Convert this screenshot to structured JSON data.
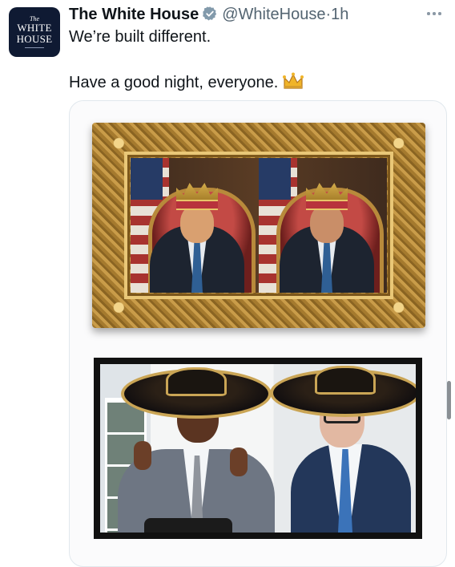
{
  "account": {
    "name": "The White House",
    "handle": "@WhiteHouse",
    "separator": "·",
    "time": "1h",
    "verified_color": "#829aab",
    "avatar": {
      "line1": "The",
      "line2": "WHITE",
      "line3": "HOUSE",
      "background": "#0f1a33"
    }
  },
  "tweet": {
    "line1": "We’re built different.",
    "line2": "Have a good night, everyone.",
    "emoji_icon": "crown-icon"
  },
  "media": {
    "image1": {
      "type": "framed-painting",
      "description_icon": "portrait-painting"
    },
    "image2": {
      "type": "photo",
      "description_icon": "press-photo"
    }
  },
  "icons": {
    "more": "more-options-icon",
    "verified": "verified-badge-icon"
  }
}
